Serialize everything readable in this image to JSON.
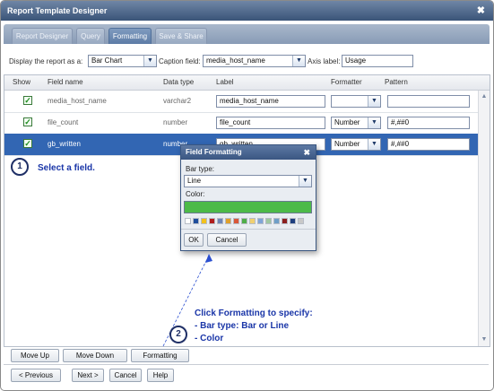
{
  "window": {
    "title": "Report Template Designer",
    "close_glyph": "✖"
  },
  "tabs": [
    {
      "label": "Report Designer",
      "active": false
    },
    {
      "label": "Query",
      "active": false
    },
    {
      "label": "Formatting",
      "active": true
    },
    {
      "label": "Save & Share",
      "active": false
    }
  ],
  "controls": {
    "display_label": "Display the report as a:",
    "display_value": "Bar Chart",
    "caption_label": "Caption field:",
    "caption_value": "media_host_name",
    "axis_label": "Axis label:",
    "axis_value": "Usage"
  },
  "table": {
    "columns": [
      "Show",
      "Field name",
      "Data type",
      "Label",
      "Formatter",
      "Pattern"
    ],
    "rows": [
      {
        "show": true,
        "field": "media_host_name",
        "type": "varchar2",
        "label": "media_host_name",
        "formatter": "",
        "pattern": "",
        "selected": false
      },
      {
        "show": true,
        "field": "file_count",
        "type": "number",
        "label": "file_count",
        "formatter": "Number",
        "pattern": "#,##0",
        "selected": false
      },
      {
        "show": true,
        "field": "gb_written",
        "type": "number",
        "label": "gb_written",
        "formatter": "Number",
        "pattern": "#,##0",
        "selected": true
      }
    ]
  },
  "popup": {
    "title": "Field Formatting",
    "close_glyph": "✖",
    "bar_type_label": "Bar type:",
    "bar_type_value": "Line",
    "color_label": "Color:",
    "selected_color": "#4cba48",
    "palette": [
      "#ffffff",
      "#1f4e9c",
      "#f2c21b",
      "#b01e1e",
      "#6e86b8",
      "#e0a02a",
      "#d9573a",
      "#4fae4a",
      "#f0d070",
      "#7fa5d8",
      "#a0c8a0",
      "#6f9fc8",
      "#8b1f1f",
      "#1e3f7f",
      "#c8c8c8"
    ],
    "ok_label": "OK",
    "cancel_label": "Cancel"
  },
  "annotations": {
    "step1_number": "1",
    "step1_text": "Select a field.",
    "step2_number": "2",
    "step2_line1": "Click Formatting to specify:",
    "step2_line2": "- Bar type: Bar or Line",
    "step2_line3": "- Color"
  },
  "bottom_buttons": {
    "move_up": "Move Up",
    "move_down": "Move Down",
    "formatting": "Formatting"
  },
  "footer_buttons": {
    "previous": "< Previous",
    "next": "Next >",
    "cancel": "Cancel",
    "help": "Help"
  }
}
